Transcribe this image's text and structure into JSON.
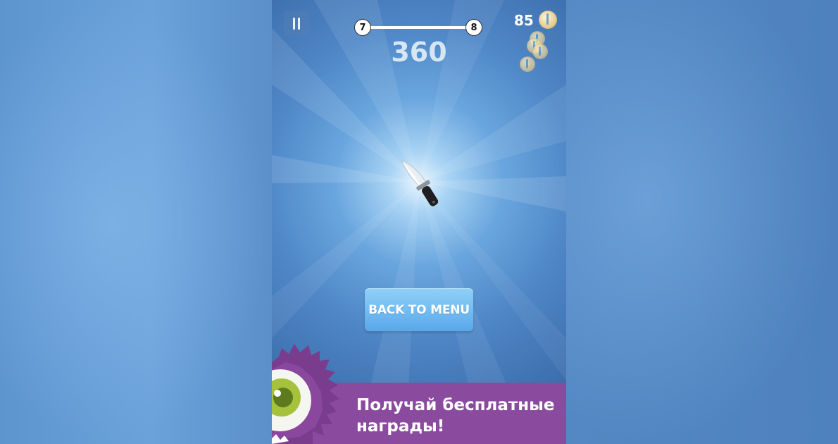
{
  "hud": {
    "level_progress": {
      "from": "7",
      "to": "8"
    },
    "score": "360",
    "coin_count": "85"
  },
  "icons": {
    "pause": "pause-icon",
    "coin": "coin-icon",
    "knife": "knife-icon",
    "monster": "purple-monster-mascot"
  },
  "actions": {
    "back_to_menu": "BACK TO MENU"
  },
  "promo_banner": {
    "line1": "Получай бесплатные",
    "line2": "награды!"
  },
  "colors": {
    "button": "#71bbf2",
    "promo_background": "#8a4b9e",
    "background": "#4e86c6"
  }
}
